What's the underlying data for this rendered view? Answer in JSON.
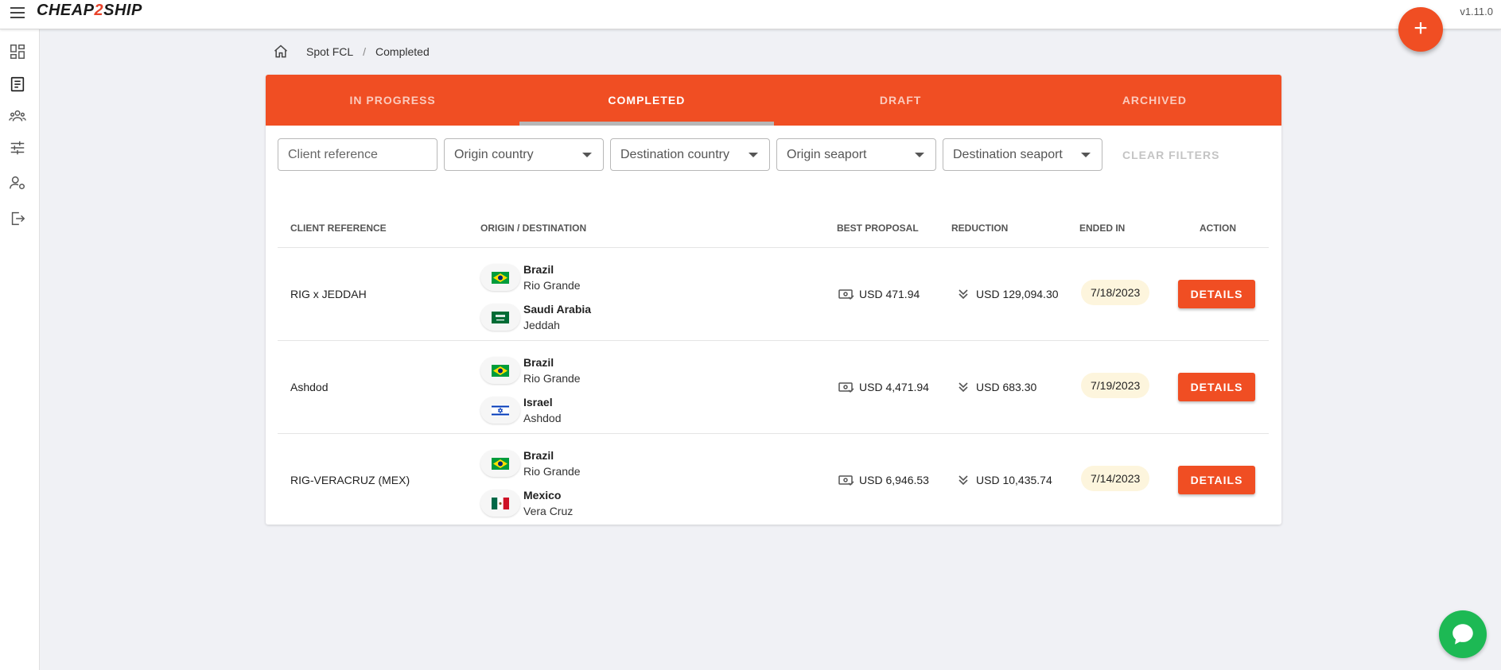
{
  "app": {
    "logo_prefix": "CHEAP",
    "logo_two": "2",
    "logo_suffix": "SHIP",
    "version": "v1.11.0",
    "fab_label": "+"
  },
  "sidebar": {
    "items": [
      {
        "name": "dashboard-icon"
      },
      {
        "name": "document-list-icon"
      },
      {
        "name": "users-group-icon"
      },
      {
        "name": "sliders-icon"
      },
      {
        "name": "user-settings-icon"
      },
      {
        "name": "logout-icon"
      }
    ]
  },
  "breadcrumb": {
    "items": [
      "Spot FCL",
      "Completed"
    ],
    "separator": "/"
  },
  "tabs": [
    {
      "label": "IN PROGRESS",
      "active": false
    },
    {
      "label": "COMPLETED",
      "active": true
    },
    {
      "label": "DRAFT",
      "active": false
    },
    {
      "label": "ARCHIVED",
      "active": false
    }
  ],
  "filters": {
    "client_reference_placeholder": "Client reference",
    "origin_country": "Origin country",
    "destination_country": "Destination country",
    "origin_seaport": "Origin seaport",
    "destination_seaport": "Destination seaport",
    "clear_label": "CLEAR FILTERS"
  },
  "table": {
    "headers": {
      "client_reference": "CLIENT REFERENCE",
      "origin_destination": "ORIGIN / DESTINATION",
      "best_proposal": "BEST PROPOSAL",
      "reduction": "REDUCTION",
      "ended_in": "ENDED IN",
      "action": "ACTION"
    },
    "action_label": "DETAILS",
    "rows": [
      {
        "ref": "RIG x JEDDAH",
        "origin": {
          "country": "Brazil",
          "city": "Rio Grande",
          "flag": "brazil-flag-icon"
        },
        "destination": {
          "country": "Saudi Arabia",
          "city": "Jeddah",
          "flag": "saudi-arabia-flag-icon"
        },
        "proposal": "USD 471.94",
        "reduction": "USD 129,094.30",
        "ended": "7/18/2023"
      },
      {
        "ref": "Ashdod",
        "origin": {
          "country": "Brazil",
          "city": "Rio Grande",
          "flag": "brazil-flag-icon"
        },
        "destination": {
          "country": "Israel",
          "city": "Ashdod",
          "flag": "israel-flag-icon"
        },
        "proposal": "USD 4,471.94",
        "reduction": "USD 683.30",
        "ended": "7/19/2023"
      },
      {
        "ref": "RIG-VERACRUZ (MEX)",
        "origin": {
          "country": "Brazil",
          "city": "Rio Grande",
          "flag": "brazil-flag-icon"
        },
        "destination": {
          "country": "Mexico",
          "city": "Vera Cruz",
          "flag": "mexico-flag-icon"
        },
        "proposal": "USD 6,946.53",
        "reduction": "USD 10,435.74",
        "ended": "7/14/2023"
      }
    ]
  },
  "colors": {
    "accent": "#f04e23",
    "chat": "#1db954",
    "background": "#f0f1f5",
    "date_chip": "#fdf5dd"
  }
}
